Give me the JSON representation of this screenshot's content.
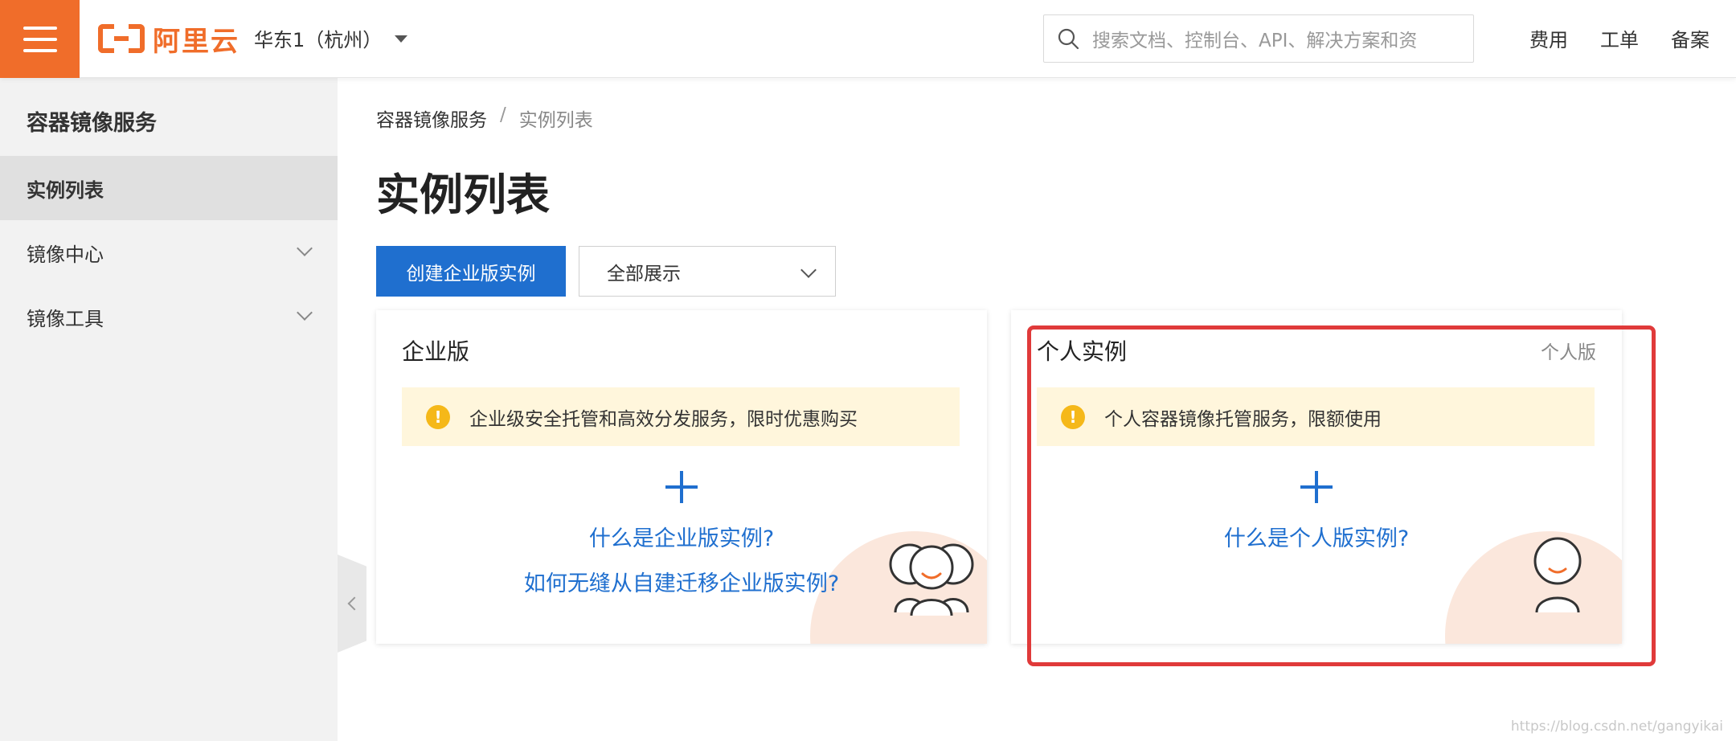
{
  "header": {
    "logo_text": "阿里云",
    "region": "华东1（杭州）",
    "search_placeholder": "搜索文档、控制台、API、解决方案和资",
    "links": [
      "费用",
      "工单",
      "备案"
    ]
  },
  "sidebar": {
    "title": "容器镜像服务",
    "items": [
      {
        "label": "实例列表",
        "active": true
      },
      {
        "label": "镜像中心",
        "expandable": true
      },
      {
        "label": "镜像工具",
        "expandable": true
      }
    ]
  },
  "breadcrumb": {
    "root": "容器镜像服务",
    "separator": "/",
    "current": "实例列表"
  },
  "page_title": "实例列表",
  "toolbar": {
    "create_label": "创建企业版实例",
    "filter_value": "全部展示"
  },
  "cards": {
    "enterprise": {
      "title": "企业版",
      "notice": "企业级安全托管和高效分发服务，限时优惠购买",
      "link1": "什么是企业版实例?",
      "link2": "如何无缝从自建迁移企业版实例?"
    },
    "personal": {
      "title": "个人实例",
      "badge": "个人版",
      "notice": "个人容器镜像托管服务，限额使用",
      "link1": "什么是个人版实例?"
    }
  },
  "colors": {
    "brand": "#f06d2a",
    "primary": "#1f6fcf",
    "highlight": "#e03a3a",
    "notice_bg": "#fff6dc"
  },
  "watermark": "https://blog.csdn.net/gangyikai"
}
